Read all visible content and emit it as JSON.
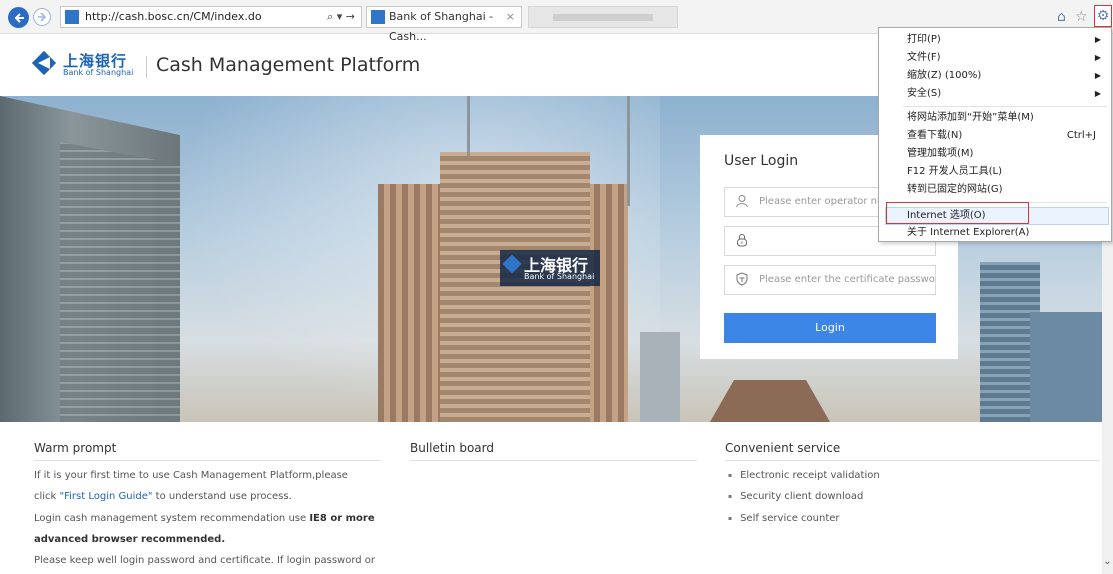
{
  "browser": {
    "url": "http://cash.bosc.cn/CM/index.do",
    "address_tools": "⌕ ▾ →",
    "tab_title": "Bank of Shanghai - Cash...",
    "tab_close": "×"
  },
  "header": {
    "bank_name_cn": "上海银行",
    "bank_name_en": "Bank of Shanghai",
    "platform_title": "Cash Management Platform"
  },
  "banner": {
    "sign_cn": "上海银行",
    "sign_en": "Bank of Shanghai",
    "slides": 3,
    "active_slide": 2
  },
  "login": {
    "title": "User Login",
    "operator_placeholder": "Please enter operator nu",
    "password_placeholder": "",
    "cert_placeholder": "Please enter the certificate password",
    "button": "Login"
  },
  "warm_prompt": {
    "title": "Warm prompt",
    "line1": "If it is your first time to use Cash Management Platform,please",
    "line2_pre": "click ",
    "line2_link": "\"First Login Guide\"",
    "line2_post": " to understand use process.",
    "line3_pre": "Login cash management system recommendation use ",
    "line3_bold": "IE8 or more",
    "line4_bold": "advanced browser recommended.",
    "line5": "Please keep well login password and certificate. If login password or"
  },
  "bulletin": {
    "title": "Bulletin board"
  },
  "services": {
    "title": "Convenient service",
    "items": [
      "Electronic receipt validation",
      "Security client download",
      "Self service counter"
    ]
  },
  "tools_menu": {
    "items": [
      {
        "label": "打印(P)",
        "submenu": true
      },
      {
        "label": "文件(F)",
        "submenu": true
      },
      {
        "label": "缩放(Z) (100%)",
        "submenu": true
      },
      {
        "label": "安全(S)",
        "submenu": true
      },
      {
        "label": "将网站添加到“开始”菜单(M)"
      },
      {
        "label": "查看下载(N)",
        "shortcut": "Ctrl+J"
      },
      {
        "label": "管理加载项(M)"
      },
      {
        "label": "F12 开发人员工具(L)"
      },
      {
        "label": "转到已固定的网站(G)"
      },
      {
        "label": "Internet 选项(O)",
        "highlighted": true
      },
      {
        "label": "关于 Internet Explorer(A)"
      }
    ]
  },
  "colors": {
    "brand_blue": "#1d63b6",
    "login_button": "#3c86e8",
    "annotation_red": "#dd3333"
  }
}
